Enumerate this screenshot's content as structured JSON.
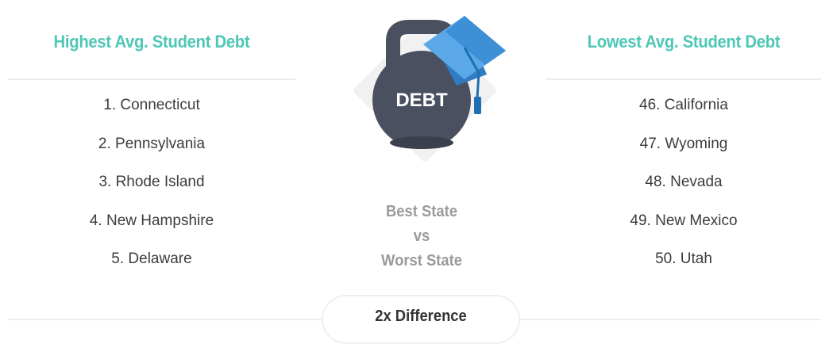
{
  "left": {
    "title": "Highest Avg. Student Debt",
    "items": [
      "1. Connecticut",
      "2. Pennsylvania",
      "3. Rhode Island",
      "4. New Hampshire",
      "5. Delaware"
    ]
  },
  "right": {
    "title": "Lowest Avg. Student Debt",
    "items": [
      "46. California",
      "47. Wyoming",
      "48. Nevada",
      "49. New Mexico",
      "50. Utah"
    ]
  },
  "center": {
    "weight_label": "DEBT",
    "compare": [
      "Best State",
      "vs",
      "Worst State"
    ],
    "difference": "2x Difference"
  },
  "colors": {
    "accent": "#4fc7b6",
    "weight": "#4a5060",
    "cap": "#3d8fd6",
    "tassel": "#1f6fb2"
  },
  "icons": [
    "kettlebell-icon",
    "graduation-cap-icon"
  ]
}
